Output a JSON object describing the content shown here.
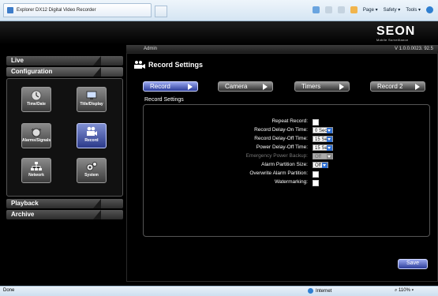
{
  "browser": {
    "tab_title": "Explorer DX12 Digital Video Recorder",
    "toolbar": {
      "page_label": "Page ▾",
      "safety_label": "Safety ▾",
      "tools_label": "Tools ▾"
    },
    "status": {
      "left": "Done",
      "zone": "Internet",
      "zoom": "⌕ 110% ▾"
    }
  },
  "header": {
    "logo_word": "SEON",
    "logo_tagline": "Mobile Surveillance",
    "user": "Admin",
    "version": "V 1.0.0.0023. 92.5"
  },
  "sidebar": {
    "live": "Live",
    "configuration": "Configuration",
    "playback": "Playback",
    "archive": "Archive",
    "config_buttons": [
      {
        "label": "Time/Date",
        "icon": "clock-icon"
      },
      {
        "label": "Title/Display",
        "icon": "monitor-icon"
      },
      {
        "label": "Alarms/Signals",
        "icon": "alarm-icon"
      },
      {
        "label": "Record",
        "icon": "camera-icon",
        "selected": true
      },
      {
        "label": "Network",
        "icon": "network-icon"
      },
      {
        "label": "System",
        "icon": "gears-icon"
      }
    ]
  },
  "page": {
    "title": "Record Settings",
    "tabs": [
      "Record",
      "Camera",
      "Timers",
      "Record 2"
    ],
    "section_title": "Record Settings",
    "fields": {
      "repeat_record": "Repeat Record:",
      "delay_on_label": "Record Delay-On Time:",
      "delay_on_value": "0 Sec.",
      "delay_off_label": "Record Delay-Off Time:",
      "delay_off_value": "15 Sec.",
      "power_delay_label": "Power Delay-Off Time:",
      "power_delay_value": "15 Sec.",
      "emergency_label": "Emergency Power Backup:",
      "emergency_value": "Off",
      "partition_label": "Alarm Partition Size:",
      "partition_value": "Off",
      "overwrite_label": "Overwrite Alarm Partition:",
      "watermark_label": "Watermarking:"
    },
    "save": "Save"
  }
}
